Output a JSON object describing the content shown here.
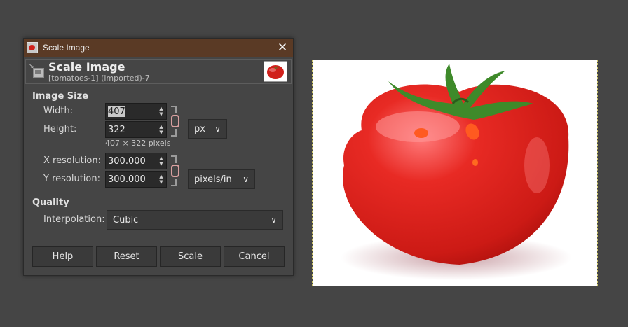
{
  "window": {
    "title": "Scale Image",
    "close_glyph": "✕",
    "app_icon": "gimp-tomato-icon"
  },
  "header": {
    "title": "Scale Image",
    "subtitle": "[tomatoes-1] (imported)-7",
    "icon": "scale-image-icon"
  },
  "image_size": {
    "section_title": "Image Size",
    "width_label": "Width:",
    "width_value": "407",
    "height_label": "Height:",
    "height_value": "322",
    "unit": "px",
    "pixels_info": "407 × 322 pixels",
    "xres_label": "X resolution:",
    "xres_value": "300.000",
    "yres_label": "Y resolution:",
    "yres_value": "300.000",
    "res_unit": "pixels/in"
  },
  "quality": {
    "section_title": "Quality",
    "interpolation_label": "Interpolation:",
    "interpolation_value": "Cubic"
  },
  "buttons": {
    "help": "Help",
    "reset": "Reset",
    "scale": "Scale",
    "cancel": "Cancel"
  },
  "colors": {
    "titlebar": "#5a3a25",
    "dialog_bg": "#454545",
    "chain_link": "#d9a0a0",
    "tomato_red": "#d0201b"
  }
}
